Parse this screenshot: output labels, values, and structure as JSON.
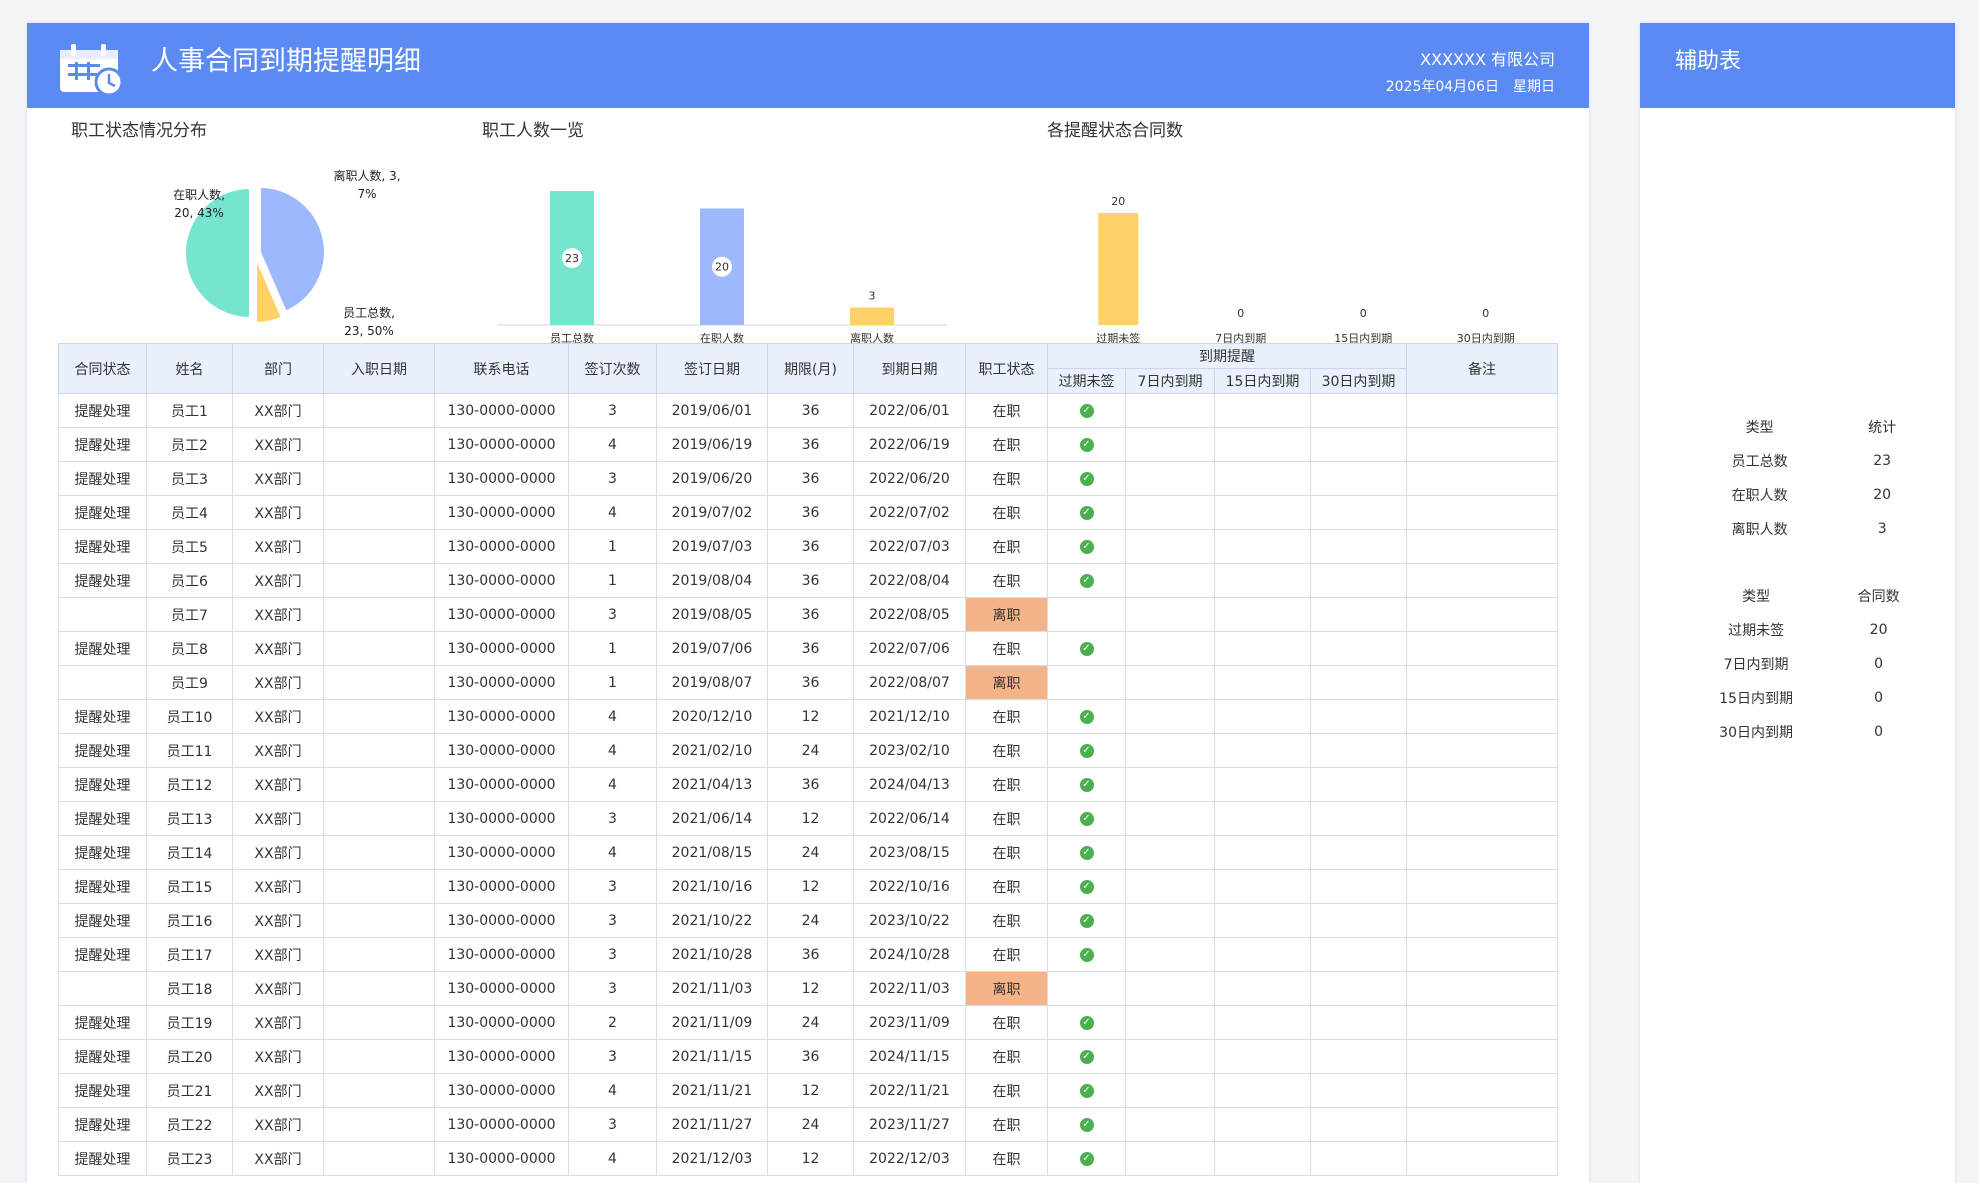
{
  "header": {
    "title": "人事合同到期提醒明细",
    "company": "XXXXXX 有限公司",
    "date": "2025年04月06日",
    "weekday": "星期日"
  },
  "colors": {
    "header_bg": "#5b8af2",
    "pie_onjob": "#9db8fb",
    "pie_left": "#ffd166",
    "pie_total": "#76e4cf",
    "remind_text": "#ee3333",
    "left_status_bg": "#f5b38a",
    "check_icon": "#4caf50"
  },
  "chart_data": [
    {
      "type": "pie",
      "title": "职工状态情况分布",
      "categories": [
        "在职人数",
        "离职人数",
        "员工总数"
      ],
      "values": [
        20,
        3,
        23
      ],
      "percent": [
        "43%",
        "7%",
        "50%"
      ],
      "labels": [
        [
          "在职人数,",
          "20, 43%"
        ],
        [
          "离职人数, 3,",
          "7%"
        ],
        [
          "员工总数,",
          "23, 50%"
        ]
      ]
    },
    {
      "type": "bar",
      "title": "职工人数一览",
      "categories": [
        "员工总数",
        "在职人数",
        "离职人数"
      ],
      "values": [
        23,
        20,
        3
      ],
      "ylim": [
        0,
        23
      ],
      "colors": [
        "#76e4cf",
        "#9db8fb",
        "#ffd166"
      ]
    },
    {
      "type": "bar",
      "title": "各提醒状态合同数",
      "categories": [
        "过期未签",
        "7日内到期",
        "15日内到期",
        "30日内到期"
      ],
      "values": [
        20,
        0,
        0,
        0
      ],
      "ylim": [
        0,
        20
      ],
      "colors": [
        "#ffd166",
        "#ffd166",
        "#ffd166",
        "#ffd166"
      ]
    }
  ],
  "table": {
    "headers": {
      "status": "合同状态",
      "name": "姓名",
      "dept": "部门",
      "join": "入职日期",
      "phone": "联系电话",
      "times": "签订次数",
      "sign": "签订日期",
      "term": "期限(月)",
      "due": "到期日期",
      "empstat": "职工状态",
      "reminder": "到期提醒",
      "r_overdue": "过期未签",
      "r7": "7日内到期",
      "r15": "15日内到期",
      "r30": "30日内到期",
      "note": "备注"
    },
    "rows": [
      {
        "status": "提醒处理",
        "name": "员工1",
        "dept": "XX部门",
        "join": "",
        "phone": "130-0000-0000",
        "times": "3",
        "sign": "2019/06/01",
        "term": "36",
        "due": "2022/06/01",
        "empstat": "在职",
        "overdue": true
      },
      {
        "status": "提醒处理",
        "name": "员工2",
        "dept": "XX部门",
        "join": "",
        "phone": "130-0000-0000",
        "times": "4",
        "sign": "2019/06/19",
        "term": "36",
        "due": "2022/06/19",
        "empstat": "在职",
        "overdue": true
      },
      {
        "status": "提醒处理",
        "name": "员工3",
        "dept": "XX部门",
        "join": "",
        "phone": "130-0000-0000",
        "times": "3",
        "sign": "2019/06/20",
        "term": "36",
        "due": "2022/06/20",
        "empstat": "在职",
        "overdue": true
      },
      {
        "status": "提醒处理",
        "name": "员工4",
        "dept": "XX部门",
        "join": "",
        "phone": "130-0000-0000",
        "times": "4",
        "sign": "2019/07/02",
        "term": "36",
        "due": "2022/07/02",
        "empstat": "在职",
        "overdue": true
      },
      {
        "status": "提醒处理",
        "name": "员工5",
        "dept": "XX部门",
        "join": "",
        "phone": "130-0000-0000",
        "times": "1",
        "sign": "2019/07/03",
        "term": "36",
        "due": "2022/07/03",
        "empstat": "在职",
        "overdue": true
      },
      {
        "status": "提醒处理",
        "name": "员工6",
        "dept": "XX部门",
        "join": "",
        "phone": "130-0000-0000",
        "times": "1",
        "sign": "2019/08/04",
        "term": "36",
        "due": "2022/08/04",
        "empstat": "在职",
        "overdue": true
      },
      {
        "status": "",
        "name": "员工7",
        "dept": "XX部门",
        "join": "",
        "phone": "130-0000-0000",
        "times": "3",
        "sign": "2019/08/05",
        "term": "36",
        "due": "2022/08/05",
        "empstat": "离职",
        "overdue": false
      },
      {
        "status": "提醒处理",
        "name": "员工8",
        "dept": "XX部门",
        "join": "",
        "phone": "130-0000-0000",
        "times": "1",
        "sign": "2019/07/06",
        "term": "36",
        "due": "2022/07/06",
        "empstat": "在职",
        "overdue": true
      },
      {
        "status": "",
        "name": "员工9",
        "dept": "XX部门",
        "join": "",
        "phone": "130-0000-0000",
        "times": "1",
        "sign": "2019/08/07",
        "term": "36",
        "due": "2022/08/07",
        "empstat": "离职",
        "overdue": false
      },
      {
        "status": "提醒处理",
        "name": "员工10",
        "dept": "XX部门",
        "join": "",
        "phone": "130-0000-0000",
        "times": "4",
        "sign": "2020/12/10",
        "term": "12",
        "due": "2021/12/10",
        "empstat": "在职",
        "overdue": true
      },
      {
        "status": "提醒处理",
        "name": "员工11",
        "dept": "XX部门",
        "join": "",
        "phone": "130-0000-0000",
        "times": "4",
        "sign": "2021/02/10",
        "term": "24",
        "due": "2023/02/10",
        "empstat": "在职",
        "overdue": true
      },
      {
        "status": "提醒处理",
        "name": "员工12",
        "dept": "XX部门",
        "join": "",
        "phone": "130-0000-0000",
        "times": "4",
        "sign": "2021/04/13",
        "term": "36",
        "due": "2024/04/13",
        "empstat": "在职",
        "overdue": true
      },
      {
        "status": "提醒处理",
        "name": "员工13",
        "dept": "XX部门",
        "join": "",
        "phone": "130-0000-0000",
        "times": "3",
        "sign": "2021/06/14",
        "term": "12",
        "due": "2022/06/14",
        "empstat": "在职",
        "overdue": true
      },
      {
        "status": "提醒处理",
        "name": "员工14",
        "dept": "XX部门",
        "join": "",
        "phone": "130-0000-0000",
        "times": "4",
        "sign": "2021/08/15",
        "term": "24",
        "due": "2023/08/15",
        "empstat": "在职",
        "overdue": true
      },
      {
        "status": "提醒处理",
        "name": "员工15",
        "dept": "XX部门",
        "join": "",
        "phone": "130-0000-0000",
        "times": "3",
        "sign": "2021/10/16",
        "term": "12",
        "due": "2022/10/16",
        "empstat": "在职",
        "overdue": true
      },
      {
        "status": "提醒处理",
        "name": "员工16",
        "dept": "XX部门",
        "join": "",
        "phone": "130-0000-0000",
        "times": "3",
        "sign": "2021/10/22",
        "term": "24",
        "due": "2023/10/22",
        "empstat": "在职",
        "overdue": true
      },
      {
        "status": "提醒处理",
        "name": "员工17",
        "dept": "XX部门",
        "join": "",
        "phone": "130-0000-0000",
        "times": "3",
        "sign": "2021/10/28",
        "term": "36",
        "due": "2024/10/28",
        "empstat": "在职",
        "overdue": true
      },
      {
        "status": "",
        "name": "员工18",
        "dept": "XX部门",
        "join": "",
        "phone": "130-0000-0000",
        "times": "3",
        "sign": "2021/11/03",
        "term": "12",
        "due": "2022/11/03",
        "empstat": "离职",
        "overdue": false
      },
      {
        "status": "提醒处理",
        "name": "员工19",
        "dept": "XX部门",
        "join": "",
        "phone": "130-0000-0000",
        "times": "2",
        "sign": "2021/11/09",
        "term": "24",
        "due": "2023/11/09",
        "empstat": "在职",
        "overdue": true
      },
      {
        "status": "提醒处理",
        "name": "员工20",
        "dept": "XX部门",
        "join": "",
        "phone": "130-0000-0000",
        "times": "3",
        "sign": "2021/11/15",
        "term": "36",
        "due": "2024/11/15",
        "empstat": "在职",
        "overdue": true
      },
      {
        "status": "提醒处理",
        "name": "员工21",
        "dept": "XX部门",
        "join": "",
        "phone": "130-0000-0000",
        "times": "4",
        "sign": "2021/11/21",
        "term": "12",
        "due": "2022/11/21",
        "empstat": "在职",
        "overdue": true
      },
      {
        "status": "提醒处理",
        "name": "员工22",
        "dept": "XX部门",
        "join": "",
        "phone": "130-0000-0000",
        "times": "3",
        "sign": "2021/11/27",
        "term": "24",
        "due": "2023/11/27",
        "empstat": "在职",
        "overdue": true
      },
      {
        "status": "提醒处理",
        "name": "员工23",
        "dept": "XX部门",
        "join": "",
        "phone": "130-0000-0000",
        "times": "4",
        "sign": "2021/12/03",
        "term": "12",
        "due": "2022/12/03",
        "empstat": "在职",
        "overdue": true
      }
    ]
  },
  "aux": {
    "title": "辅助表",
    "table1": {
      "headers": [
        "类型",
        "统计"
      ],
      "rows": [
        [
          "员工总数",
          "23"
        ],
        [
          "在职人数",
          "20"
        ],
        [
          "离职人数",
          "3"
        ]
      ]
    },
    "table2": {
      "headers": [
        "类型",
        "合同数"
      ],
      "rows": [
        [
          "过期未签",
          "20"
        ],
        [
          "7日内到期",
          "0"
        ],
        [
          "15日内到期",
          "0"
        ],
        [
          "30日内到期",
          "0"
        ]
      ]
    }
  }
}
